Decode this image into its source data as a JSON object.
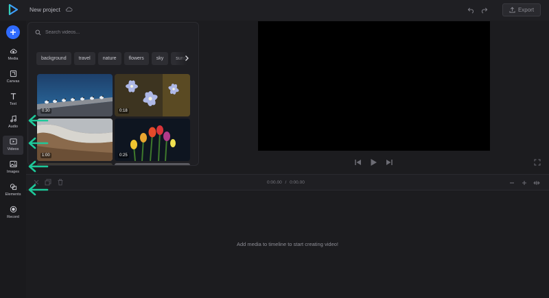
{
  "header": {
    "project_title": "New project",
    "export_label": "Export"
  },
  "nav": {
    "items": [
      {
        "label": "Media",
        "icon": "upload-cloud-icon"
      },
      {
        "label": "Canvas",
        "icon": "canvas-icon"
      },
      {
        "label": "Text",
        "icon": "text-icon"
      },
      {
        "label": "Audio",
        "icon": "music-note-icon"
      },
      {
        "label": "Videos",
        "icon": "video-icon"
      },
      {
        "label": "Images",
        "icon": "image-icon"
      },
      {
        "label": "Elements",
        "icon": "elements-icon"
      },
      {
        "label": "Record",
        "icon": "record-icon"
      }
    ],
    "active": "Videos"
  },
  "media_panel": {
    "search_placeholder": "Search videos...",
    "categories": [
      "background",
      "travel",
      "nature",
      "flowers",
      "sky",
      "sunset"
    ],
    "videos": [
      {
        "duration": "0:30",
        "subject": "seagulls on pier"
      },
      {
        "duration": "0:18",
        "subject": "blue flowers"
      },
      {
        "duration": "1:00",
        "subject": "beach waves"
      },
      {
        "duration": "0:25",
        "subject": "tulips"
      }
    ]
  },
  "timeline": {
    "current_time": "0:00.00",
    "separator": "/",
    "total_time": "0:00.00",
    "empty_message": "Add media to timeline to start creating video!"
  },
  "colors": {
    "accent": "#2f6bff",
    "arrow": "#1ec99a",
    "background": "#1c1c1f"
  }
}
